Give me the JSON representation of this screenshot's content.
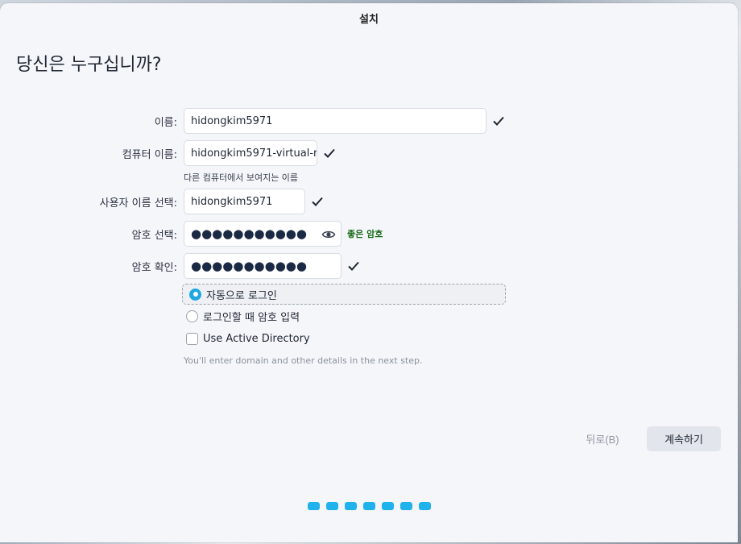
{
  "window": {
    "title": "설치"
  },
  "page": {
    "title": "당신은 누구십니까?"
  },
  "form": {
    "name": {
      "label": "이름:",
      "value": "hidongkim5971"
    },
    "computer_name": {
      "label": "컴퓨터 이름:",
      "value": "hidongkim5971-virtual-r",
      "hint": "다른 컴퓨터에서 보여지는 이름"
    },
    "username": {
      "label": "사용자 이름 선택:",
      "value": "hidongkim5971"
    },
    "password": {
      "label": "암호 선택:",
      "value": "●●●●●●●●●●●",
      "strength": "좋은 암호"
    },
    "confirm_password": {
      "label": "암호 확인:",
      "value": "●●●●●●●●●●●"
    }
  },
  "login_options": {
    "auto_login": {
      "label": "자동으로 로그인",
      "selected": true
    },
    "require_password": {
      "label": "로그인할 때 암호 입력",
      "selected": false
    },
    "active_directory": {
      "label": "Use Active Directory",
      "checked": false
    },
    "note": "You'll enter domain and other details in the next step."
  },
  "buttons": {
    "back": "뒤로(B)",
    "next": "계속하기"
  },
  "progress": {
    "steps": 7
  },
  "colors": {
    "accent": "#1fb2ec",
    "strength_good": "#1a6b1a"
  }
}
